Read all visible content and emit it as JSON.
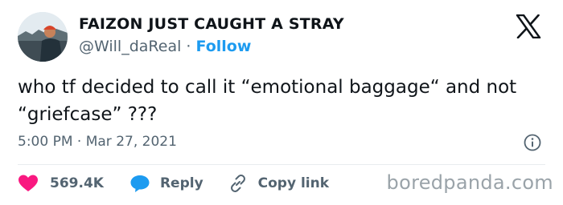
{
  "author": {
    "display_name": "FAIZON JUST CAUGHT A STRAY",
    "handle": "@Will_daReal",
    "separator": "·",
    "follow_label": "Follow"
  },
  "tweet": {
    "text": "who tf decided to call it “emotional baggage“ and not “griefcase” ???",
    "timestamp": "5:00 PM · Mar 27, 2021"
  },
  "actions": {
    "like_count": "569.4K",
    "reply_label": "Reply",
    "copy_link_label": "Copy link"
  },
  "watermark": "boredpanda.com",
  "icons": {
    "logo": "x-logo-icon",
    "info": "info-icon",
    "like": "heart-icon",
    "reply": "speech-bubble-icon",
    "copy": "link-icon"
  },
  "colors": {
    "link_blue": "#1d9bf0",
    "heart_red": "#f91880",
    "secondary_text": "#536471",
    "primary_text": "#0f1419"
  }
}
